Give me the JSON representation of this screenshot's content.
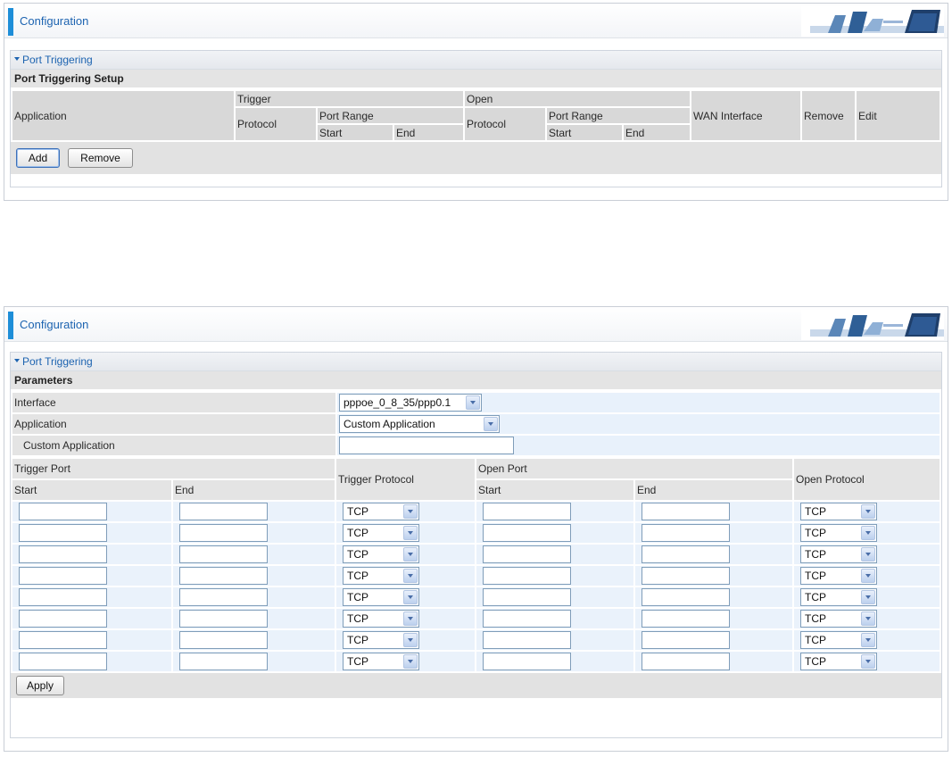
{
  "panel1": {
    "config_title": "Configuration",
    "section_title": "Port Triggering",
    "subheader": "Port Triggering Setup",
    "columns": {
      "application": "Application",
      "trigger": "Trigger",
      "open": "Open",
      "protocol": "Protocol",
      "port_range": "Port Range",
      "start": "Start",
      "end": "End",
      "wan_interface": "WAN Interface",
      "remove": "Remove",
      "edit": "Edit"
    },
    "buttons": {
      "add": "Add",
      "remove": "Remove"
    }
  },
  "panel2": {
    "config_title": "Configuration",
    "section_title": "Port Triggering",
    "subheader": "Parameters",
    "interface_label": "Interface",
    "interface_value": "pppoe_0_8_35/ppp0.1",
    "application_label": "Application",
    "application_value": "Custom Application",
    "custom_app_label": "Custom Application",
    "custom_app_value": "",
    "headers": {
      "trigger_port": "Trigger Port",
      "trigger_protocol": "Trigger Protocol",
      "open_port": "Open Port",
      "open_protocol": "Open Protocol",
      "start": "Start",
      "end": "End"
    },
    "rows": [
      {
        "trigger_start": "",
        "trigger_end": "",
        "trigger_protocol": "TCP",
        "open_start": "",
        "open_end": "",
        "open_protocol": "TCP"
      },
      {
        "trigger_start": "",
        "trigger_end": "",
        "trigger_protocol": "TCP",
        "open_start": "",
        "open_end": "",
        "open_protocol": "TCP"
      },
      {
        "trigger_start": "",
        "trigger_end": "",
        "trigger_protocol": "TCP",
        "open_start": "",
        "open_end": "",
        "open_protocol": "TCP"
      },
      {
        "trigger_start": "",
        "trigger_end": "",
        "trigger_protocol": "TCP",
        "open_start": "",
        "open_end": "",
        "open_protocol": "TCP"
      },
      {
        "trigger_start": "",
        "trigger_end": "",
        "trigger_protocol": "TCP",
        "open_start": "",
        "open_end": "",
        "open_protocol": "TCP"
      },
      {
        "trigger_start": "",
        "trigger_end": "",
        "trigger_protocol": "TCP",
        "open_start": "",
        "open_end": "",
        "open_protocol": "TCP"
      },
      {
        "trigger_start": "",
        "trigger_end": "",
        "trigger_protocol": "TCP",
        "open_start": "",
        "open_end": "",
        "open_protocol": "TCP"
      },
      {
        "trigger_start": "",
        "trigger_end": "",
        "trigger_protocol": "TCP",
        "open_start": "",
        "open_end": "",
        "open_protocol": "TCP"
      }
    ],
    "buttons": {
      "apply": "Apply"
    }
  },
  "colors": {
    "accent": "#1e8ed8",
    "title_text": "#1c63b0",
    "header_gray": "#d8d8d8",
    "row_blue": "#eaf2fb"
  }
}
